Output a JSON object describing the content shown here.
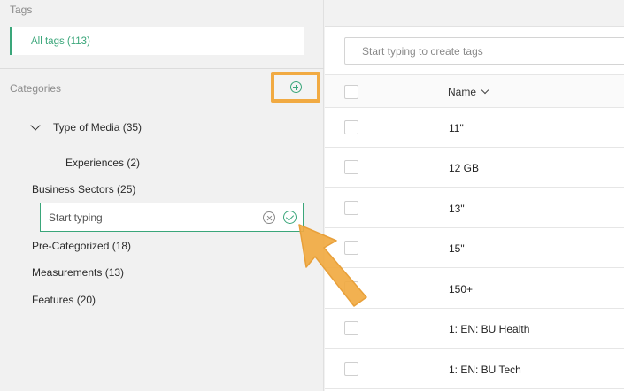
{
  "tags": {
    "section_label": "Tags",
    "all_tags_label": "All tags (113)"
  },
  "categories": {
    "section_label": "Categories",
    "items": [
      {
        "label": "Type of Media (35)"
      },
      {
        "label": "Experiences (2)"
      },
      {
        "label": "Business Sectors (25)"
      },
      {
        "label": "Pre-Categorized (18)"
      },
      {
        "label": "Measurements (13)"
      },
      {
        "label": "Features (20)"
      }
    ],
    "new_category_placeholder": "Start typing"
  },
  "tag_list": {
    "search_placeholder": "Start typing to create tags",
    "name_header": "Name",
    "rows": [
      "11\"",
      "12 GB",
      "13\"",
      "15\"",
      "150+",
      "1: EN: BU Health",
      "1: EN: BU Tech"
    ]
  },
  "colors": {
    "accent": "#3aa67a",
    "highlight": "#f1aa42"
  }
}
